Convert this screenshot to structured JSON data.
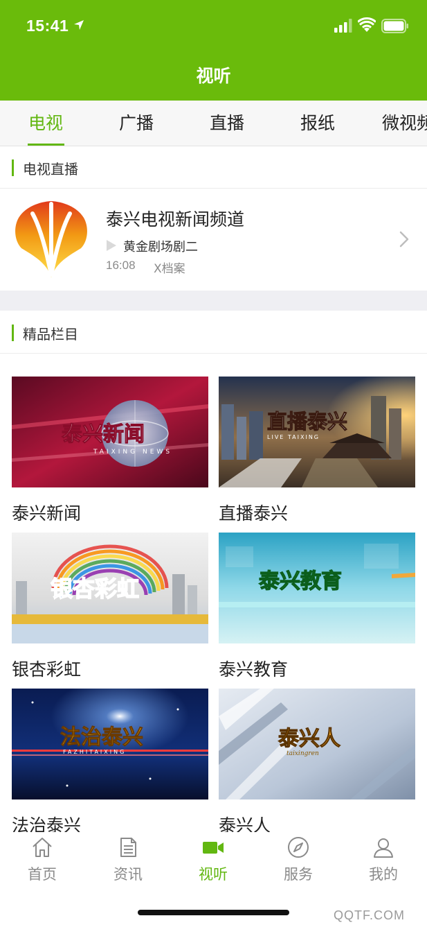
{
  "status_bar": {
    "time": "15:41"
  },
  "header": {
    "title": "视听"
  },
  "tabs": [
    {
      "label": "电视",
      "active": true
    },
    {
      "label": "广播",
      "active": false
    },
    {
      "label": "直播",
      "active": false
    },
    {
      "label": "报纸",
      "active": false
    },
    {
      "label": "微视频",
      "active": false
    }
  ],
  "live_section": {
    "title": "电视直播",
    "channel": {
      "name": "泰兴电视新闻频道",
      "program": "黄金剧场剧二",
      "time": "16:08",
      "next_show": "X档案"
    }
  },
  "featured_section": {
    "title": "精品栏目",
    "items": [
      {
        "title": "泰兴新闻",
        "thumb_text": "泰兴新闻",
        "thumb_subtext": "TAIXING NEWS"
      },
      {
        "title": "直播泰兴",
        "thumb_text": "直播泰兴",
        "thumb_subtext": "LIVE TAIXING"
      },
      {
        "title": "银杏彩虹",
        "thumb_text": "银杏彩虹",
        "thumb_subtext": ""
      },
      {
        "title": "泰兴教育",
        "thumb_text": "泰兴教育",
        "thumb_subtext": ""
      },
      {
        "title": "法治泰兴",
        "thumb_text": "法治泰兴",
        "thumb_subtext": "FAZHITAIXING"
      },
      {
        "title": "泰兴人",
        "thumb_text": "泰兴人",
        "thumb_subtext": "taixingren"
      }
    ]
  },
  "bottom_nav": [
    {
      "label": "首页",
      "icon": "home-icon",
      "active": false
    },
    {
      "label": "资讯",
      "icon": "document-icon",
      "active": false
    },
    {
      "label": "视听",
      "icon": "video-camera-icon",
      "active": true
    },
    {
      "label": "服务",
      "icon": "compass-icon",
      "active": false
    },
    {
      "label": "我的",
      "icon": "user-icon",
      "active": false
    }
  ],
  "watermark": "QQTF.COM",
  "colors": {
    "brand_green": "#6abb0b",
    "active_green": "#62b711",
    "text_gray": "#8a8a8a"
  }
}
